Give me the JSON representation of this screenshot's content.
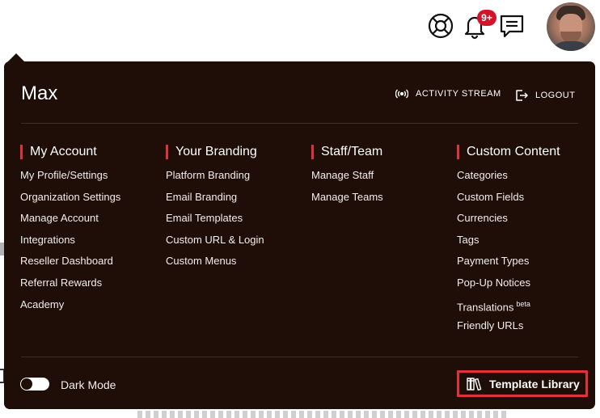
{
  "topbar": {
    "icons": [
      "lifebuoy-icon",
      "bell-icon",
      "chat-icon"
    ],
    "notification_badge": "9+",
    "avatar": "user-avatar"
  },
  "menu": {
    "user_name": "Max",
    "activity_stream_label": "ACTIVITY STREAM",
    "logout_label": "LOGOUT",
    "columns": [
      {
        "title": "My Account",
        "links": [
          "My Profile/Settings",
          "Organization Settings",
          "Manage Account",
          "Integrations",
          "Reseller Dashboard",
          "Referral Rewards",
          "Academy"
        ]
      },
      {
        "title": "Your Branding",
        "links": [
          "Platform Branding",
          "Email Branding",
          "Email Templates",
          "Custom URL & Login",
          "Custom Menus"
        ]
      },
      {
        "title": "Staff/Team",
        "links": [
          "Manage Staff",
          "Manage Teams"
        ]
      },
      {
        "title": "Custom Content",
        "links": [
          "Categories",
          "Custom Fields",
          "Currencies",
          "Tags",
          "Payment Types",
          "Pop-Up Notices",
          "Translations",
          "Friendly URLs"
        ],
        "translations_badge": "beta"
      }
    ],
    "dark_mode_label": "Dark Mode",
    "dark_mode_on": true,
    "template_library_label": "Template Library"
  },
  "colors": {
    "panel_bg": "#1e0e07",
    "accent": "#e0323a",
    "badge": "#d2142a"
  }
}
